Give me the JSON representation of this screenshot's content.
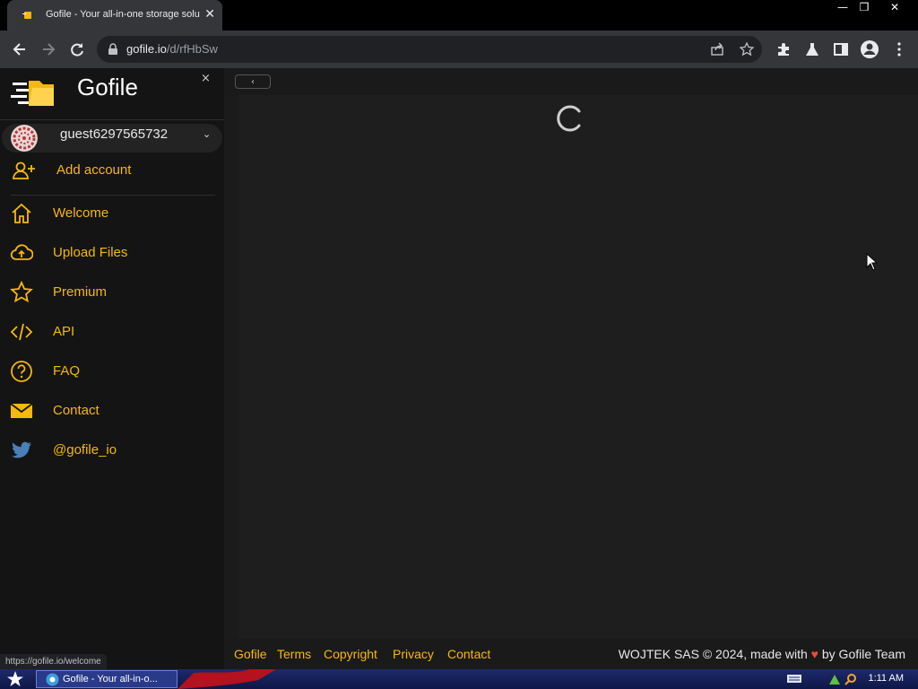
{
  "browser": {
    "tab_title": "Gofile - Your all-in-one storage solution",
    "url_host": "gofile.io",
    "url_path": "/d/rfHbSw",
    "status_url": "https://gofile.io/welcome",
    "window_buttons": {
      "minimize": "—",
      "restore": "❐",
      "close": "✕"
    },
    "tab_close": "✕"
  },
  "sidebar": {
    "brand": "Gofile",
    "close_glyph": "×",
    "account": {
      "name": "guest6297565732",
      "chevron": "⌄"
    },
    "add_account": "Add account",
    "items": [
      {
        "label": "Welcome",
        "icon": "home-icon"
      },
      {
        "label": "Upload Files",
        "icon": "cloud-upload-icon"
      },
      {
        "label": "Premium",
        "icon": "star-icon"
      },
      {
        "label": "API",
        "icon": "code-icon"
      },
      {
        "label": "FAQ",
        "icon": "question-icon"
      },
      {
        "label": "Contact",
        "icon": "envelope-icon"
      },
      {
        "label": "@gofile_io",
        "icon": "twitter-icon"
      }
    ]
  },
  "main": {
    "collapse_glyph": "‹",
    "loading": true
  },
  "footer": {
    "links": [
      "Gofile",
      "Terms",
      "Copyright",
      "Privacy",
      "Contact"
    ],
    "copyright_prefix": "WOJTEK SAS © 2024, made with",
    "heart": "♥",
    "copyright_suffix": "by Gofile Team"
  },
  "taskbar": {
    "window_label": "Gofile - Your all-in-o...",
    "clock": "1:11 AM"
  },
  "colors": {
    "accent": "#f5b80c",
    "sidebar_bg": "#141414",
    "main_bg": "#1e1e1e",
    "twitter_blue": "#4a7fb8"
  }
}
